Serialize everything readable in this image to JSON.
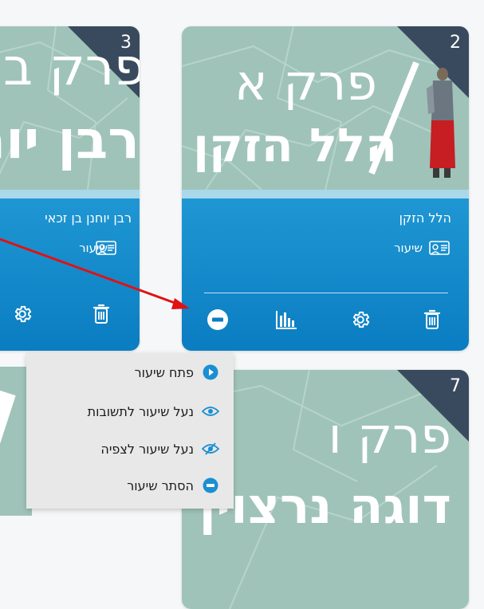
{
  "cards": [
    {
      "number": "2",
      "title_line1": "פרק א",
      "title_line2": "הלל הזקן",
      "lesson_name": "הלל הזקן",
      "lesson_type": "שיעור"
    },
    {
      "number": "3",
      "title_line1": "פרק ב",
      "title_line2": "רבן יוחנן",
      "lesson_name": "רבן יוחנן בן זכאי",
      "lesson_type": "שיעור"
    },
    {
      "number": "7",
      "title_line1": "פרק ו",
      "title_line2": "דוגה נרצוין"
    }
  ],
  "context_menu": {
    "items": [
      {
        "label": "פתח שיעור",
        "icon": "play-circle-icon"
      },
      {
        "label": "נעל שיעור לתשובות",
        "icon": "eye-icon"
      },
      {
        "label": "נעל שיעור לצפיה",
        "icon": "eye-slash-icon"
      },
      {
        "label": "הסתר שיעור",
        "icon": "minus-circle-icon"
      }
    ]
  },
  "colors": {
    "card_blue": "#0a7dc2",
    "card_top": "#9fc3b8",
    "corner": "#3a4a5e",
    "arrow": "#e01212",
    "menu_icon": "#1b8fd2"
  }
}
